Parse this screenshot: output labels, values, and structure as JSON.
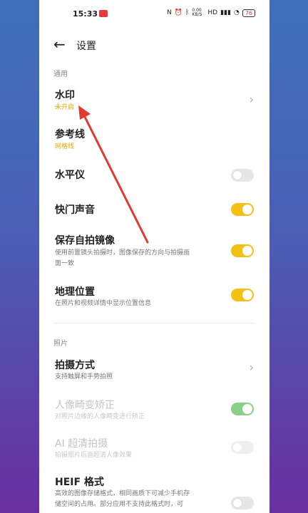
{
  "status_bar": {
    "time": "15:33",
    "net_speed": "0.00 KB/S",
    "battery": "76"
  },
  "header": {
    "back_icon": "arrow-left-icon",
    "title": "设置"
  },
  "sections": {
    "general": "通用",
    "photo": "照片"
  },
  "rows": {
    "watermark": {
      "title": "水印",
      "sub": "未开启"
    },
    "reference_line": {
      "title": "参考线",
      "sub": "网格线"
    },
    "level": {
      "title": "水平仪"
    },
    "shutter_sound": {
      "title": "快门声音"
    },
    "save_selfie": {
      "title": "保存自拍镜像",
      "sub": "使用前置镜头拍摄时，图像保存的方向与拍摄画",
      "sub2": "面一致"
    },
    "location": {
      "title": "地理位置",
      "sub": "在照片和视频详情中显示位置信息"
    },
    "shoot_method": {
      "title": "拍摄方式",
      "sub": "支持触屏和手势拍照"
    },
    "portrait_distort": {
      "title": "人像畸变矫正",
      "sub": "对照片边缘的人像畸变进行矫正"
    },
    "ai_clear": {
      "title": "AI 超清拍摄",
      "sub": "拍摄照片后画超清人像效果"
    },
    "heif": {
      "title": "HEIF 格式",
      "sub": "高效的图像存储格式，相同画质下可减少手机存",
      "sub2": "储空间的占用。部分应用不支持此格式时，可"
    }
  },
  "colors": {
    "accent": "#f5c014",
    "arrow": "#e23a2e",
    "green_toggle": "#8bcf8a"
  }
}
